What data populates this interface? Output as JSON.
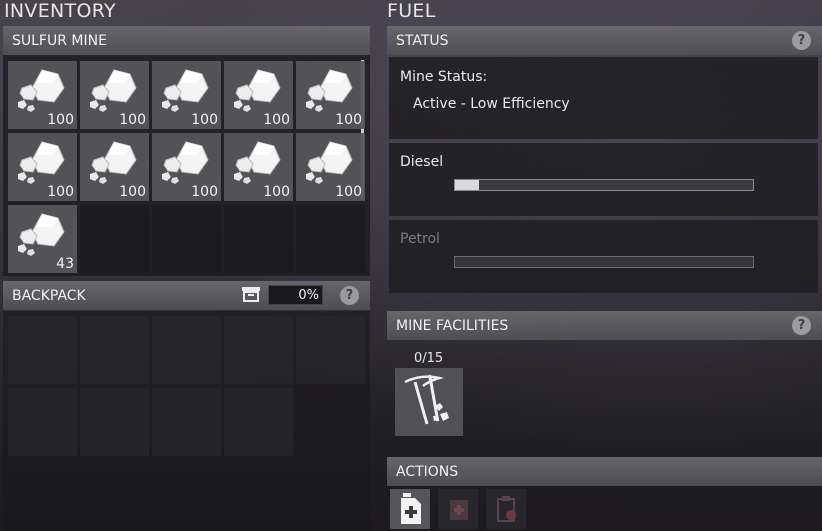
{
  "inventory": {
    "title": "INVENTORY",
    "sulfur_mine": {
      "header": "SULFUR MINE",
      "slots": [
        {
          "item": "sulfur-ore-icon",
          "qty": "100"
        },
        {
          "item": "sulfur-ore-icon",
          "qty": "100"
        },
        {
          "item": "sulfur-ore-icon",
          "qty": "100"
        },
        {
          "item": "sulfur-ore-icon",
          "qty": "100"
        },
        {
          "item": "sulfur-ore-icon",
          "qty": "100"
        },
        {
          "item": "sulfur-ore-icon",
          "qty": "100"
        },
        {
          "item": "sulfur-ore-icon",
          "qty": "100"
        },
        {
          "item": "sulfur-ore-icon",
          "qty": "100"
        },
        {
          "item": "sulfur-ore-icon",
          "qty": "100"
        },
        {
          "item": "sulfur-ore-icon",
          "qty": "100"
        },
        {
          "item": "sulfur-ore-icon",
          "qty": "43"
        }
      ],
      "empty_slot_count": 4
    },
    "backpack": {
      "header": "BACKPACK",
      "capacity": "0%",
      "help": "?",
      "slot_count": 9
    }
  },
  "fuel": {
    "title": "FUEL",
    "status": {
      "header": "STATUS",
      "help": "?",
      "mine_status_label": "Mine Status:",
      "mine_status_value": "Active - Low Efficiency"
    },
    "diesel": {
      "label": "Diesel",
      "fill_fraction": 0.08
    },
    "petrol": {
      "label": "Petrol",
      "fill_fraction": 0.0
    }
  },
  "mine_facilities": {
    "header": "MINE FACILITIES",
    "help": "?",
    "count": "0/15",
    "item": "pickaxe-icon"
  },
  "actions": {
    "header": "ACTIONS",
    "buttons": [
      {
        "icon": "add-fuel-canister-icon",
        "enabled": true
      },
      {
        "icon": "add-medkit-icon",
        "enabled": false
      },
      {
        "icon": "clipboard-remove-icon",
        "enabled": false
      }
    ]
  },
  "colors": {
    "header_bg": "#5f5e66",
    "slot_filled": "#56565a",
    "help_circle": "#9b9b9f"
  }
}
